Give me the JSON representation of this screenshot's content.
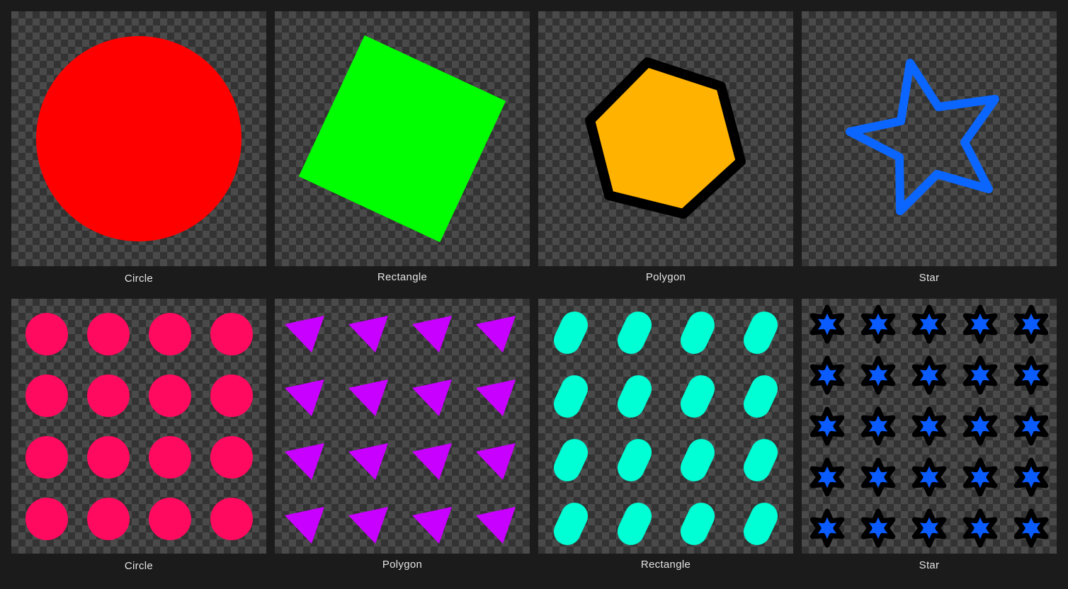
{
  "tiles": [
    {
      "label": "Circle",
      "shape": "circle",
      "color": "#ff0000"
    },
    {
      "label": "Rectangle",
      "shape": "rectangle",
      "color": "#00ff00"
    },
    {
      "label": "Polygon",
      "shape": "hexagon",
      "color": "#ffb300",
      "stroke": "#000000"
    },
    {
      "label": "Star",
      "shape": "star-outline",
      "color": "#0a66ff"
    },
    {
      "label": "Circle",
      "shape": "circle-pattern",
      "color": "#ff0a5e"
    },
    {
      "label": "Polygon",
      "shape": "triangle-pattern",
      "color": "#c800ff"
    },
    {
      "label": "Rectangle",
      "shape": "capsule-pattern",
      "color": "#00ffd5"
    },
    {
      "label": "Star",
      "shape": "star-pattern",
      "color": "#0a5cff",
      "stroke": "#000000"
    }
  ]
}
